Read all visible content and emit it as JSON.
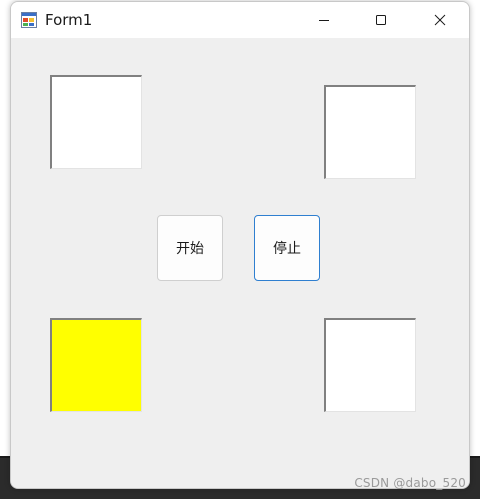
{
  "window": {
    "title": "Form1",
    "icon": "winforms-app-icon",
    "controls": {
      "minimize_icon": "minimize-icon",
      "maximize_icon": "maximize-icon",
      "close_icon": "close-icon"
    }
  },
  "form": {
    "panels": [
      {
        "position": "top-left",
        "color": "#ffffff"
      },
      {
        "position": "top-right",
        "color": "#ffffff"
      },
      {
        "position": "bottom-left",
        "color": "#ffff00"
      },
      {
        "position": "bottom-right",
        "color": "#ffffff"
      }
    ],
    "buttons": {
      "start_label": "开始",
      "stop_label": "停止"
    }
  },
  "watermark": "CSDN @dabo_520",
  "colors": {
    "form_background": "#efefef",
    "titlebar": "#ffffff",
    "focus_border": "#2f7fd0",
    "highlight": "#ffff00"
  }
}
